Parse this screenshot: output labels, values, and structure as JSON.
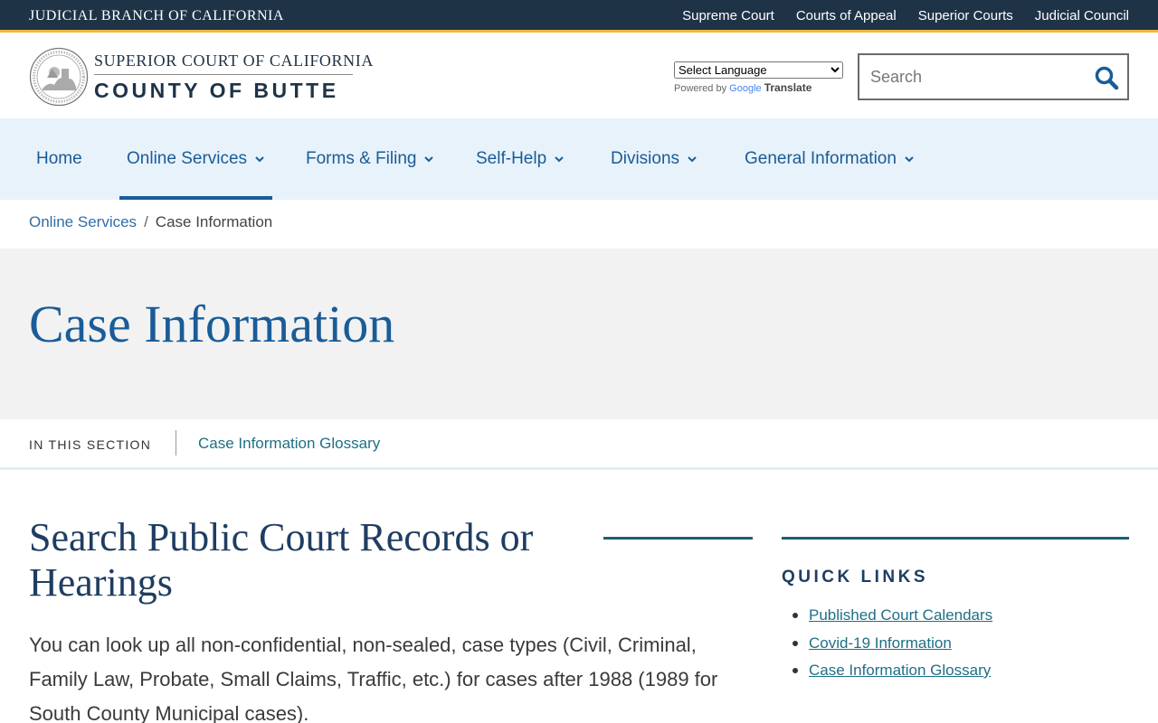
{
  "topbar": {
    "brand": "JUDICIAL BRANCH OF CALIFORNIA",
    "links": [
      "Supreme Court",
      "Courts of Appeal",
      "Superior Courts",
      "Judicial Council"
    ]
  },
  "header": {
    "court_line1": "SUPERIOR COURT OF CALIFORNIA",
    "court_line2": "COUNTY OF BUTTE",
    "language_select": "Select Language",
    "powered_by": "Powered by",
    "google": "Google",
    "translate": "Translate",
    "search_placeholder": "Search"
  },
  "nav": {
    "items": [
      {
        "label": "Home"
      },
      {
        "label": "Online Services"
      },
      {
        "label": "Forms & Filing"
      },
      {
        "label": "Self-Help"
      },
      {
        "label": "Divisions"
      },
      {
        "label": "General Information"
      }
    ]
  },
  "breadcrumb": {
    "parent": "Online Services",
    "separator": "/",
    "current": "Case Information"
  },
  "page": {
    "title": "Case Information"
  },
  "section": {
    "label": "IN THIS SECTION",
    "link": "Case Information Glossary"
  },
  "main": {
    "title": "Search Public Court Records or Hearings",
    "body": "You can look up all non-confidential, non-sealed, case types (Civil, Criminal, Family Law, Probate, Small Claims, Traffic, etc.) for cases after 1988 (1989 for South County Municipal cases)."
  },
  "quick_links": {
    "title": "QUICK LINKS",
    "items": [
      "Published Court Calendars",
      "Covid-19 Information",
      "Case Information Glossary"
    ]
  },
  "colors": {
    "topbar": "#1f3347",
    "accent_gold": "#f0b63c",
    "link_blue": "#1a5c97",
    "nav_bg": "#e8f2fa",
    "title_band": "#f2f2f2",
    "teal": "#1f5f74"
  }
}
